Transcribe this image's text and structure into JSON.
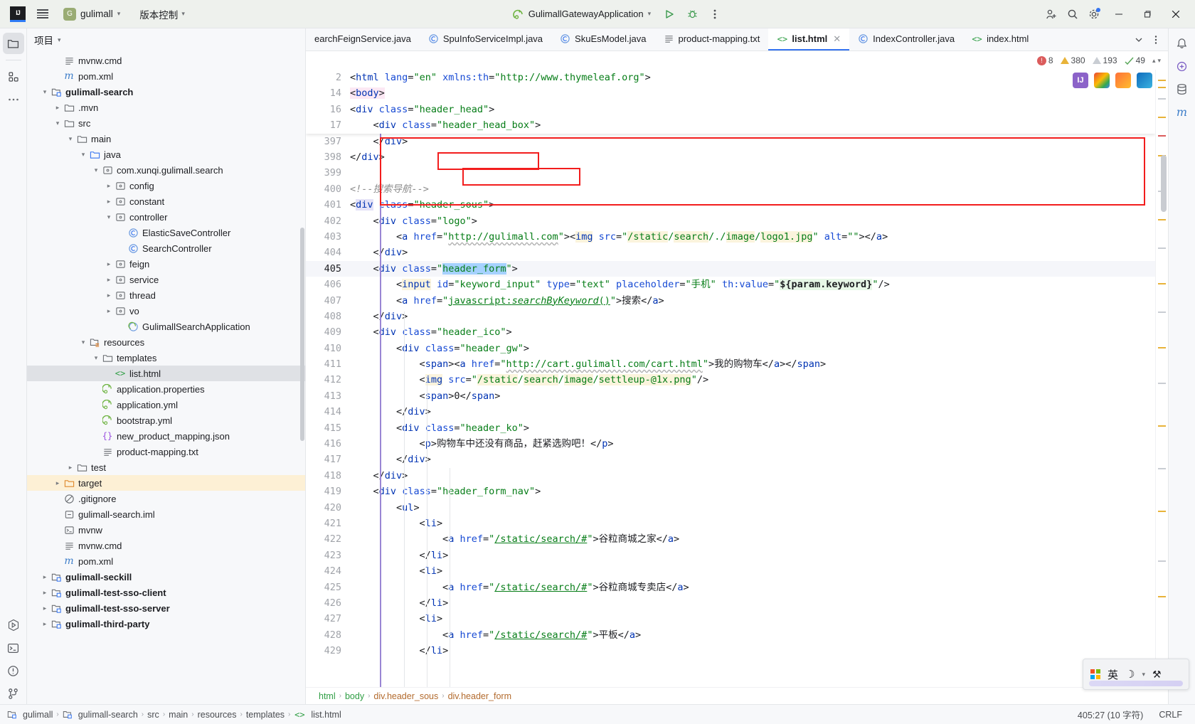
{
  "titlebar": {
    "logo": "IJ",
    "menu_icon": "hamburger-icon",
    "project_badge": "G",
    "project_name": "gulimall",
    "vcs_label": "版本控制",
    "run_config": "GulimallGatewayApplication",
    "icons": {
      "run": "run-icon",
      "debug": "debug-icon",
      "more": "more-vertical-icon",
      "add_user": "add-user-icon",
      "search": "search-icon",
      "settings": "settings-icon",
      "minimize": "minimize-icon",
      "maximize": "maximize-icon",
      "close": "close-icon"
    }
  },
  "project_panel": {
    "title": "项目",
    "tree": [
      {
        "indent": 4,
        "arrow": "",
        "icon": "txt",
        "label": "mvnw.cmd",
        "bold": false
      },
      {
        "indent": 4,
        "arrow": "",
        "icon": "maven",
        "label": "pom.xml",
        "bold": false
      },
      {
        "indent": 3,
        "arrow": "down",
        "icon": "module",
        "label": "gulimall-search",
        "bold": true
      },
      {
        "indent": 4,
        "arrow": "right",
        "icon": "folder",
        "label": ".mvn",
        "bold": false
      },
      {
        "indent": 4,
        "arrow": "down",
        "icon": "folder",
        "label": "src",
        "bold": false
      },
      {
        "indent": 5,
        "arrow": "down",
        "icon": "folder",
        "label": "main",
        "bold": false
      },
      {
        "indent": 6,
        "arrow": "down",
        "icon": "folder-src",
        "label": "java",
        "bold": false
      },
      {
        "indent": 7,
        "arrow": "down",
        "icon": "package",
        "label": "com.xunqi.gulimall.search",
        "bold": false
      },
      {
        "indent": 8,
        "arrow": "right",
        "icon": "package",
        "label": "config",
        "bold": false
      },
      {
        "indent": 8,
        "arrow": "right",
        "icon": "package",
        "label": "constant",
        "bold": false
      },
      {
        "indent": 8,
        "arrow": "down",
        "icon": "package",
        "label": "controller",
        "bold": false
      },
      {
        "indent": 9,
        "arrow": "",
        "icon": "class",
        "label": "ElasticSaveController",
        "bold": false
      },
      {
        "indent": 9,
        "arrow": "",
        "icon": "class",
        "label": "SearchController",
        "bold": false
      },
      {
        "indent": 8,
        "arrow": "right",
        "icon": "package",
        "label": "feign",
        "bold": false
      },
      {
        "indent": 8,
        "arrow": "right",
        "icon": "package",
        "label": "service",
        "bold": false
      },
      {
        "indent": 8,
        "arrow": "right",
        "icon": "package",
        "label": "thread",
        "bold": false
      },
      {
        "indent": 8,
        "arrow": "right",
        "icon": "package",
        "label": "vo",
        "bold": false
      },
      {
        "indent": 9,
        "arrow": "",
        "icon": "spring",
        "label": "GulimallSearchApplication",
        "bold": false
      },
      {
        "indent": 6,
        "arrow": "down",
        "icon": "folder-res",
        "label": "resources",
        "bold": false
      },
      {
        "indent": 7,
        "arrow": "down",
        "icon": "folder",
        "label": "templates",
        "bold": false
      },
      {
        "indent": 8,
        "arrow": "",
        "icon": "html",
        "label": "list.html",
        "bold": false,
        "state": "selected"
      },
      {
        "indent": 7,
        "arrow": "",
        "icon": "spring-leaf",
        "label": "application.properties",
        "bold": false
      },
      {
        "indent": 7,
        "arrow": "",
        "icon": "spring-leaf",
        "label": "application.yml",
        "bold": false
      },
      {
        "indent": 7,
        "arrow": "",
        "icon": "spring-leaf",
        "label": "bootstrap.yml",
        "bold": false
      },
      {
        "indent": 7,
        "arrow": "",
        "icon": "json",
        "label": "new_product_mapping.json",
        "bold": false
      },
      {
        "indent": 7,
        "arrow": "",
        "icon": "txt",
        "label": "product-mapping.txt",
        "bold": false
      },
      {
        "indent": 5,
        "arrow": "right",
        "icon": "folder",
        "label": "test",
        "bold": false
      },
      {
        "indent": 4,
        "arrow": "right",
        "icon": "folder-target",
        "label": "target",
        "bold": false,
        "state": "highlight"
      },
      {
        "indent": 4,
        "arrow": "",
        "icon": "gitignore",
        "label": ".gitignore",
        "bold": false
      },
      {
        "indent": 4,
        "arrow": "",
        "icon": "iml",
        "label": "gulimall-search.iml",
        "bold": false
      },
      {
        "indent": 4,
        "arrow": "",
        "icon": "shell",
        "label": "mvnw",
        "bold": false
      },
      {
        "indent": 4,
        "arrow": "",
        "icon": "txt",
        "label": "mvnw.cmd",
        "bold": false
      },
      {
        "indent": 4,
        "arrow": "",
        "icon": "maven",
        "label": "pom.xml",
        "bold": false
      },
      {
        "indent": 3,
        "arrow": "right",
        "icon": "module",
        "label": "gulimall-seckill",
        "bold": true
      },
      {
        "indent": 3,
        "arrow": "right",
        "icon": "module",
        "label": "gulimall-test-sso-client",
        "bold": true
      },
      {
        "indent": 3,
        "arrow": "right",
        "icon": "module",
        "label": "gulimall-test-sso-server",
        "bold": true
      },
      {
        "indent": 3,
        "arrow": "right",
        "icon": "module",
        "label": "gulimall-third-party",
        "bold": true
      }
    ]
  },
  "editor": {
    "tabs": [
      {
        "label": "earchFeignService.java",
        "icon": "",
        "active": false,
        "closable": false
      },
      {
        "label": "SpuInfoServiceImpl.java",
        "icon": "class",
        "active": false,
        "closable": false
      },
      {
        "label": "SkuEsModel.java",
        "icon": "class",
        "active": false,
        "closable": false
      },
      {
        "label": "product-mapping.txt",
        "icon": "txt",
        "active": false,
        "closable": false
      },
      {
        "label": "list.html",
        "icon": "html",
        "active": true,
        "closable": true
      },
      {
        "label": "IndexController.java",
        "icon": "class",
        "active": false,
        "closable": false
      },
      {
        "label": "index.html",
        "icon": "html",
        "active": false,
        "closable": false
      }
    ],
    "inspections": {
      "errors": "8",
      "warnings": "380",
      "weak_warnings": "193",
      "typos": "49"
    },
    "sticky_lines": [
      {
        "num": "2",
        "html": "<span class='t-punct'>&lt;</span><span class='t-tag'>html</span> <span class='t-attr'>lang</span><span class='t-punct'>=</span><span class='t-str'>\"en\"</span> <span class='t-attr'>xmlns:th</span><span class='t-punct'>=</span><span class='t-str'>\"http://www.thymeleaf.org\"</span><span class='t-punct'>&gt;</span>"
      },
      {
        "num": "14",
        "html": "<span class='hl-pink'><span class='t-punct'>&lt;</span><span class='t-tag'>body</span><span class='t-punct'>&gt;</span></span>"
      },
      {
        "num": "16",
        "html": "<span class='t-punct'>&lt;</span><span class='t-tag'>div</span> <span class='t-attr'>class</span><span class='t-punct'>=</span><span class='t-str'>\"header_head\"</span><span class='t-punct'>&gt;</span>"
      },
      {
        "num": "17",
        "html": "    <span class='t-punct'>&lt;</span><span class='t-tag'>div</span> <span class='t-attr'>class</span><span class='t-punct'>=</span><span class='t-str'>\"header_head_box\"</span><span class='t-punct'>&gt;</span>"
      }
    ],
    "lines": [
      {
        "num": "397",
        "indent": 1,
        "html": "    <span class='t-punct'>&lt;/</span><span class='t-tag'>div</span><span class='t-punct'>&gt;</span>"
      },
      {
        "num": "398",
        "indent": 0,
        "html": "<span class='t-punct'>&lt;/</span><span class='t-tag'>div</span><span class='t-punct'>&gt;</span>"
      },
      {
        "num": "399",
        "indent": 0,
        "html": ""
      },
      {
        "num": "400",
        "indent": 0,
        "html": "<span class='t-com'>&lt;!--搜索导航--&gt;</span>"
      },
      {
        "num": "401",
        "indent": 0,
        "html": "<span class='t-punct'>&lt;</span><span class='t-tag' style='background:#e4e2f7'>div</span> <span class='t-attr'>class</span><span class='t-punct'>=</span><span class='t-str'>\"header_sous\"</span><span class='t-punct'>&gt;</span>"
      },
      {
        "num": "402",
        "indent": 1,
        "html": "    <span class='t-punct'>&lt;</span><span class='t-tag'>div</span> <span class='t-attr'>class</span><span class='t-punct'>=</span><span class='t-str'>\"logo\"</span><span class='t-punct'>&gt;</span>"
      },
      {
        "num": "403",
        "indent": 2,
        "html": "        <span class='t-punct'>&lt;</span><span class='t-tag'>a</span> <span class='t-attr'>href</span><span class='t-punct'>=</span><span class='t-str'>\"</span><span class='t-link squiggle'>http://gulimall.com</span><span class='t-str'>\"</span><span class='t-punct'>&gt;&lt;</span><span class='t-tag hl-yellow'>img</span> <span class='t-attr'>src</span><span class='t-punct'>=</span><span class='t-str'>\"</span><span class='hl-yellow t-str'>/static</span><span class='t-str'>/</span><span class='hl-yellow t-str'>search</span><span class='t-str'>/./</span><span class='hl-yellow t-str'>image</span><span class='t-str'>/</span><span class='hl-yellow t-str'>logo1.jpg</span><span class='t-str'>\"</span> <span class='t-attr'>alt</span><span class='t-punct'>=</span><span class='t-str'>\"\"</span><span class='t-punct'>&gt;&lt;/</span><span class='t-tag'>a</span><span class='t-punct'>&gt;</span>"
      },
      {
        "num": "404",
        "indent": 1,
        "html": "    <span class='t-punct'>&lt;/</span><span class='t-tag'>div</span><span class='t-punct'>&gt;</span>"
      },
      {
        "num": "405",
        "indent": 1,
        "current": true,
        "html": "    <span class='t-punct'>&lt;</span><span class='t-tag'>div</span> <span class='t-attr'>class</span><span class='t-punct'>=</span><span class='t-str'>\"</span><span class='hl-blue t-str'>header_form</span><span class='t-str'>\"</span><span class='t-punct'>&gt;</span>"
      },
      {
        "num": "406",
        "indent": 2,
        "html": "        <span class='t-punct'>&lt;</span><span class='t-tag hl-yellow'>input</span> <span class='t-attr'>id</span><span class='t-punct'>=</span><span class='t-str'>\"keyword_input\"</span> <span class='t-attr'>type</span><span class='t-punct'>=</span><span class='t-str'>\"text\"</span> <span class='t-attr'>placeholder</span><span class='t-punct'>=</span><span class='t-str'>\"手机\"</span> <span class='t-attr'>th:value</span><span class='t-punct'>=</span><span class='t-str'>\"</span><span class='hl-green t-punct' style='font-weight:bold'>${param.keyword}</span><span class='t-str'>\"</span><span class='t-punct'>/&gt;</span>"
      },
      {
        "num": "407",
        "indent": 2,
        "html": "        <span class='t-punct'>&lt;</span><span class='t-tag'>a</span> <span class='t-attr'>href</span><span class='t-punct'>=</span><span class='t-str'>\"</span><span class='t-link'>javascript:</span><span class='t-link t-ital'>searchByKeyword</span><span class='t-link'>()</span><span class='t-str'>\"</span><span class='t-punct'>&gt;</span><span class='t-txt'>搜索</span><span class='t-punct'>&lt;/</span><span class='t-tag'>a</span><span class='t-punct'>&gt;</span>"
      },
      {
        "num": "408",
        "indent": 1,
        "html": "    <span class='t-punct'>&lt;/</span><span class='t-tag'>div</span><span class='t-punct'>&gt;</span>"
      },
      {
        "num": "409",
        "indent": 1,
        "html": "    <span class='t-punct'>&lt;</span><span class='t-tag'>div</span> <span class='t-attr'>class</span><span class='t-punct'>=</span><span class='t-str'>\"header_ico\"</span><span class='t-punct'>&gt;</span>"
      },
      {
        "num": "410",
        "indent": 2,
        "html": "        <span class='t-punct'>&lt;</span><span class='t-tag'>div</span> <span class='t-attr'>class</span><span class='t-punct'>=</span><span class='t-str'>\"header_gw\"</span><span class='t-punct'>&gt;</span>"
      },
      {
        "num": "411",
        "indent": 3,
        "html": "            <span class='t-punct'>&lt;</span><span class='t-tag'>span</span><span class='t-punct'>&gt;&lt;</span><span class='t-tag'>a</span> <span class='t-attr'>href</span><span class='t-punct'>=</span><span class='t-str'>\"</span><span class='t-link squiggle'>http://cart.gulimall.com/cart.html</span><span class='t-str'>\"</span><span class='t-punct'>&gt;</span><span class='t-txt'>我的购物车</span><span class='t-punct'>&lt;/</span><span class='t-tag'>a</span><span class='t-punct'>&gt;&lt;/</span><span class='t-tag'>span</span><span class='t-punct'>&gt;</span>"
      },
      {
        "num": "412",
        "indent": 3,
        "html": "            <span class='t-punct'>&lt;</span><span class='t-tag hl-yellow'>img</span> <span class='t-attr'>src</span><span class='t-punct'>=</span><span class='t-str'>\"</span><span class='hl-yellow t-str'>/static</span><span class='t-str'>/</span><span class='hl-yellow t-str'>search</span><span class='t-str'>/</span><span class='hl-yellow t-str'>image</span><span class='t-str'>/</span><span class='hl-yellow t-str'>settleup-@1x.png</span><span class='t-str'>\"</span><span class='t-punct'>/&gt;</span>"
      },
      {
        "num": "413",
        "indent": 3,
        "html": "            <span class='t-punct'>&lt;</span><span class='t-tag'>span</span><span class='t-punct'>&gt;</span><span class='t-txt'>0</span><span class='t-punct'>&lt;/</span><span class='t-tag'>span</span><span class='t-punct'>&gt;</span>"
      },
      {
        "num": "414",
        "indent": 2,
        "html": "        <span class='t-punct'>&lt;/</span><span class='t-tag'>div</span><span class='t-punct'>&gt;</span>"
      },
      {
        "num": "415",
        "indent": 2,
        "html": "        <span class='t-punct'>&lt;</span><span class='t-tag'>div</span> <span class='t-attr'>class</span><span class='t-punct'>=</span><span class='t-str'>\"header_ko\"</span><span class='t-punct'>&gt;</span>"
      },
      {
        "num": "416",
        "indent": 3,
        "html": "            <span class='t-punct'>&lt;</span><span class='t-tag'>p</span><span class='t-punct'>&gt;</span><span class='t-txt'>购物车中还没有商品，赶紧选购吧！</span><span class='t-punct'>&lt;/</span><span class='t-tag'>p</span><span class='t-punct'>&gt;</span>"
      },
      {
        "num": "417",
        "indent": 2,
        "html": "        <span class='t-punct'>&lt;/</span><span class='t-tag'>div</span><span class='t-punct'>&gt;</span>"
      },
      {
        "num": "418",
        "indent": 1,
        "html": "    <span class='t-punct'>&lt;/</span><span class='t-tag'>div</span><span class='t-punct'>&gt;</span>"
      },
      {
        "num": "419",
        "indent": 1,
        "html": "    <span class='t-punct'>&lt;</span><span class='t-tag'>div</span> <span class='t-attr'>class</span><span class='t-punct'>=</span><span class='t-str'>\"header_form_nav\"</span><span class='t-punct'>&gt;</span>"
      },
      {
        "num": "420",
        "indent": 2,
        "html": "        <span class='t-punct'>&lt;</span><span class='t-tag'>ul</span><span class='t-punct'>&gt;</span>"
      },
      {
        "num": "421",
        "indent": 3,
        "html": "            <span class='t-punct'>&lt;</span><span class='t-tag'>li</span><span class='t-punct'>&gt;</span>"
      },
      {
        "num": "422",
        "indent": 4,
        "html": "                <span class='t-punct'>&lt;</span><span class='t-tag'>a</span> <span class='t-attr'>href</span><span class='t-punct'>=</span><span class='t-str'>\"</span><span class='t-link'>/static/search/#</span><span class='t-str'>\"</span><span class='t-punct'>&gt;</span><span class='t-txt'>谷粒商城之家</span><span class='t-punct'>&lt;/</span><span class='t-tag'>a</span><span class='t-punct'>&gt;</span>"
      },
      {
        "num": "423",
        "indent": 3,
        "html": "            <span class='t-punct'>&lt;/</span><span class='t-tag'>li</span><span class='t-punct'>&gt;</span>"
      },
      {
        "num": "424",
        "indent": 3,
        "html": "            <span class='t-punct'>&lt;</span><span class='t-tag'>li</span><span class='t-punct'>&gt;</span>"
      },
      {
        "num": "425",
        "indent": 4,
        "html": "                <span class='t-punct'>&lt;</span><span class='t-tag'>a</span> <span class='t-attr'>href</span><span class='t-punct'>=</span><span class='t-str'>\"</span><span class='t-link'>/static/search/#</span><span class='t-str'>\"</span><span class='t-punct'>&gt;</span><span class='t-txt'>谷粒商城专卖店</span><span class='t-punct'>&lt;/</span><span class='t-tag'>a</span><span class='t-punct'>&gt;</span>"
      },
      {
        "num": "426",
        "indent": 3,
        "html": "            <span class='t-punct'>&lt;/</span><span class='t-tag'>li</span><span class='t-punct'>&gt;</span>"
      },
      {
        "num": "427",
        "indent": 3,
        "html": "            <span class='t-punct'>&lt;</span><span class='t-tag'>li</span><span class='t-punct'>&gt;</span>"
      },
      {
        "num": "428",
        "indent": 4,
        "html": "                <span class='t-punct'>&lt;</span><span class='t-tag'>a</span> <span class='t-attr'>href</span><span class='t-punct'>=</span><span class='t-str'>\"</span><span class='t-link'>/static/search/#</span><span class='t-str'>\"</span><span class='t-punct'>&gt;</span><span class='t-txt'>平板</span><span class='t-punct'>&lt;/</span><span class='t-tag'>a</span><span class='t-punct'>&gt;</span>"
      },
      {
        "num": "429",
        "indent": 3,
        "html": "            <span class='t-punct'>&lt;/</span><span class='t-tag'>li</span><span class='t-punct'>&gt;</span>"
      }
    ],
    "breadcrumb": [
      "html",
      "body",
      "div.header_sous",
      "div.header_form"
    ]
  },
  "statusbar": {
    "crumbs": [
      "gulimall",
      "gulimall-search",
      "src",
      "main",
      "resources",
      "templates",
      "list.html"
    ],
    "caret": "405:27 (10 字符)",
    "line_separator": "CRLF"
  },
  "ime": {
    "lang": "英",
    "moon": "☽",
    "tool": "⚒"
  },
  "colors": {
    "accent": "#3574f0",
    "annotation": "#f21d1d",
    "tag": "#0033b3",
    "string": "#067d17",
    "attribute": "#174ad4",
    "titlebar_bg": "#eef1ed",
    "panel_bg": "#f7f8fa",
    "editor_bg": "#ffffff",
    "selection_highlight": "#a6d2ff",
    "target_folder_highlight": "#fdf0d5"
  }
}
